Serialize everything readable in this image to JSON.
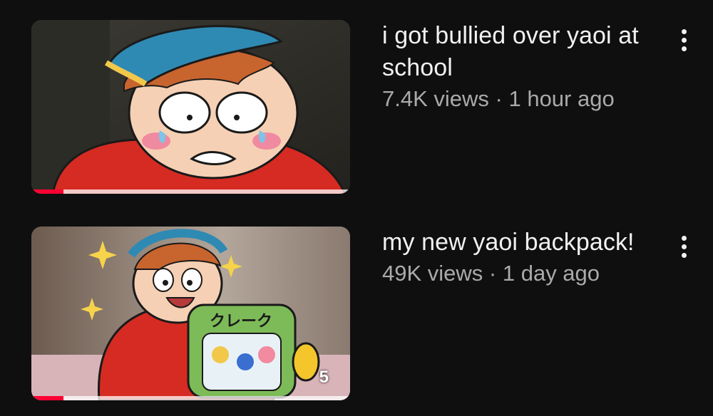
{
  "videos": [
    {
      "title": "i got bullied over yaoi at school",
      "views": "7.4K views",
      "age": "1 hour ago",
      "progress_fraction": 0.1,
      "thumbnail_icon": "cartoon-crying-boy-thumbnail"
    },
    {
      "title": "my new yaoi backpack!",
      "views": "49K views",
      "age": "1 day ago",
      "progress_fraction": 0.1,
      "thumbnail_icon": "cartoon-boy-backpack-thumbnail",
      "thumbnail_text": "5",
      "backpack_text": "クレーク"
    }
  ],
  "separator": " · ",
  "colors": {
    "background": "#0f0f0f",
    "title": "#f1f1f1",
    "meta": "#aaaaaa",
    "progress": "#ff0033"
  }
}
